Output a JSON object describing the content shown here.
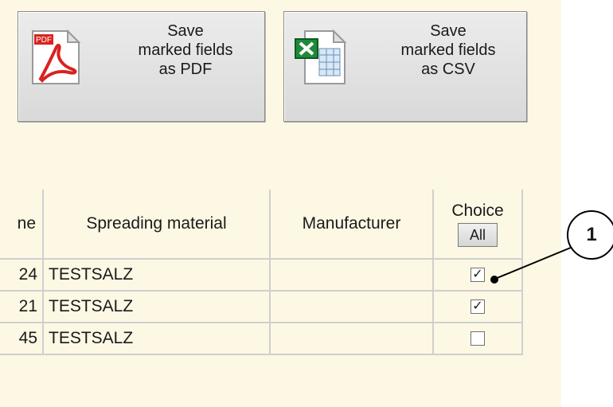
{
  "toolbar": {
    "pdf_button_label": "Save\nmarked fields\nas PDF",
    "csv_button_label": "Save\nmarked fields\nas CSV",
    "pdf_icon_text": "PDF"
  },
  "table": {
    "headers": {
      "name_partial": "ne",
      "spreading_material": "Spreading material",
      "manufacturer": "Manufacturer",
      "choice": "Choice",
      "choice_all": "All"
    },
    "rows": [
      {
        "num": "24",
        "material": "TESTSALZ",
        "manufacturer": "",
        "checked": true,
        "mark": "✓"
      },
      {
        "num": "21",
        "material": "TESTSALZ",
        "manufacturer": "",
        "checked": true,
        "mark": "✓"
      },
      {
        "num": "45",
        "material": "TESTSALZ",
        "manufacturer": "",
        "checked": false,
        "mark": ""
      }
    ]
  },
  "callout": {
    "label": "1"
  },
  "colors": {
    "panel_bg": "#fdf8e4",
    "grid": "#cfcfcf",
    "button_bg": "#e3e3e3"
  }
}
